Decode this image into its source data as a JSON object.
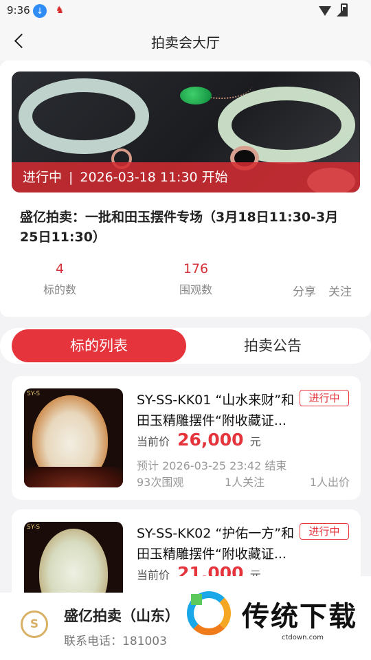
{
  "status_bar": {
    "time": "9:36",
    "icons": [
      "download-icon",
      "app-icon",
      "wifi-icon",
      "signal-icon",
      "battery-icon"
    ]
  },
  "nav": {
    "title": "拍卖会大厅",
    "back_icon": "chevron-left-icon"
  },
  "auction": {
    "status": "进行中",
    "separator": "|",
    "start_text": "2026-03-18 11:30 开始",
    "title": "盛亿拍卖：一批和田玉摆件专场（3月18日11:30-3月25日11:30）",
    "stats": [
      {
        "value": "4",
        "label": "标的数"
      },
      {
        "value": "176",
        "label": "围观数"
      }
    ],
    "actions": [
      {
        "icon": "share-icon",
        "glyph": "",
        "label": "分享"
      },
      {
        "icon": "follow-icon",
        "glyph": "",
        "label": "关注"
      }
    ]
  },
  "tabs": [
    {
      "label": "标的列表",
      "active": true
    },
    {
      "label": "拍卖公告",
      "active": false
    }
  ],
  "lots": [
    {
      "name": "SY-SS-KK01 “山水来财”和田玉精雕摆件“附收藏证...",
      "tag": "进行中",
      "price_label": "当前价",
      "price": "26,000",
      "unit": "元",
      "end_text": "预计 2026-03-25 23:42 结束",
      "views": "93次围观",
      "follows": "1人关注",
      "bids": "1人出价",
      "watermark": "SY-S"
    },
    {
      "name": "SY-SS-KK02 “护佑一方”和田玉精雕摆件“附收藏证...",
      "tag": "进行中",
      "price_label": "当前价",
      "price": "21,000",
      "unit": "元",
      "watermark": "SY-S"
    }
  ],
  "bottom": {
    "org": "盛亿拍卖（山东）",
    "phone": "联系电话：181003"
  },
  "watermark": {
    "brand": "传统下载",
    "domain": "ctdown.com"
  },
  "colors": {
    "accent": "#e5343c",
    "gold": "#d8b066"
  }
}
